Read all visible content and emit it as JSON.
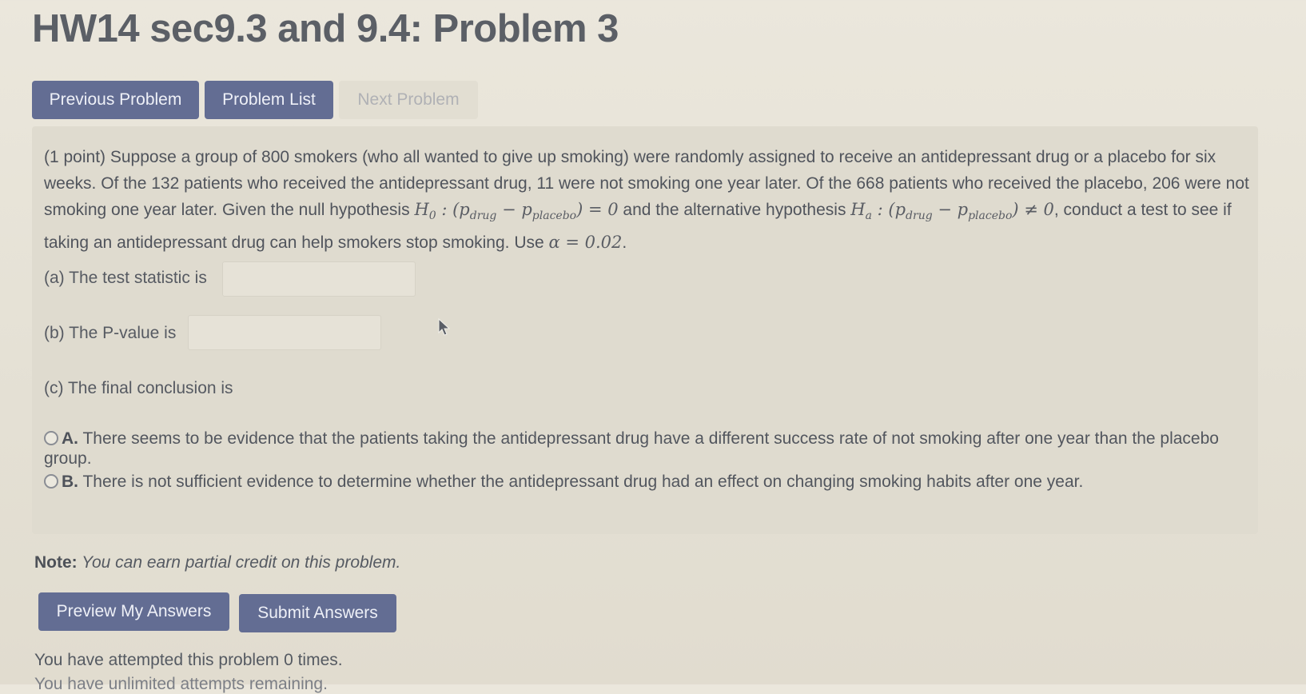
{
  "page_title": "HW14 sec9.3 and 9.4: Problem 3",
  "nav": {
    "prev_label": "Previous Problem",
    "list_label": "Problem List",
    "next_label": "Next Problem"
  },
  "problem": {
    "text_1": "(1 point) Suppose a group of 800 smokers (who all wanted to give up smoking) were randomly assigned to receive an antidepressant drug or a placebo for six weeks. Of the 132 patients who received the antidepressant drug, 11 were not smoking one year later. Of the 668 patients who received the placebo, 206 were not smoking one year later. Given the null hypothesis ",
    "h0_symbol": "H",
    "h0_sub": "0",
    "h0_expr_open": " : (p",
    "drug_sub": "drug",
    "minus": " − p",
    "placebo_sub": "placebo",
    "h0_expr_close": ") = 0",
    "text_2": " and the alternative hypothesis ",
    "ha_symbol": "H",
    "ha_sub": "a",
    "ha_expr_open": " : (p",
    "ha_drug_sub": "drug",
    "ha_minus": " − p",
    "ha_placebo_sub": "placebo",
    "ha_expr_close": ") ≠ 0",
    "text_3": ", conduct a test to see if taking an antidepressant drug can help smokers stop smoking. Use ",
    "alpha_expr": "α = 0.02",
    "text_4": ".",
    "part_a_label": "(a) The test statistic is",
    "part_a_value": "",
    "part_b_label": "(b) The P-value is",
    "part_b_value": "",
    "part_c_label": "(c) The final conclusion is",
    "choices": [
      {
        "letter": "A.",
        "text": " There seems to be evidence that the patients taking the antidepressant drug have a different success rate of not smoking after one year than the placebo group."
      },
      {
        "letter": "B.",
        "text": " There is not sufficient evidence to determine whether the antidepressant drug had an effect on changing smoking habits after one year."
      }
    ]
  },
  "note": {
    "label": "Note:",
    "text": " You can earn partial credit on this problem."
  },
  "actions": {
    "preview_label": "Preview My Answers",
    "submit_label": "Submit Answers"
  },
  "attempts_text": "You have attempted this problem 0 times.",
  "remaining_text": "You have unlimited attempts remaining."
}
